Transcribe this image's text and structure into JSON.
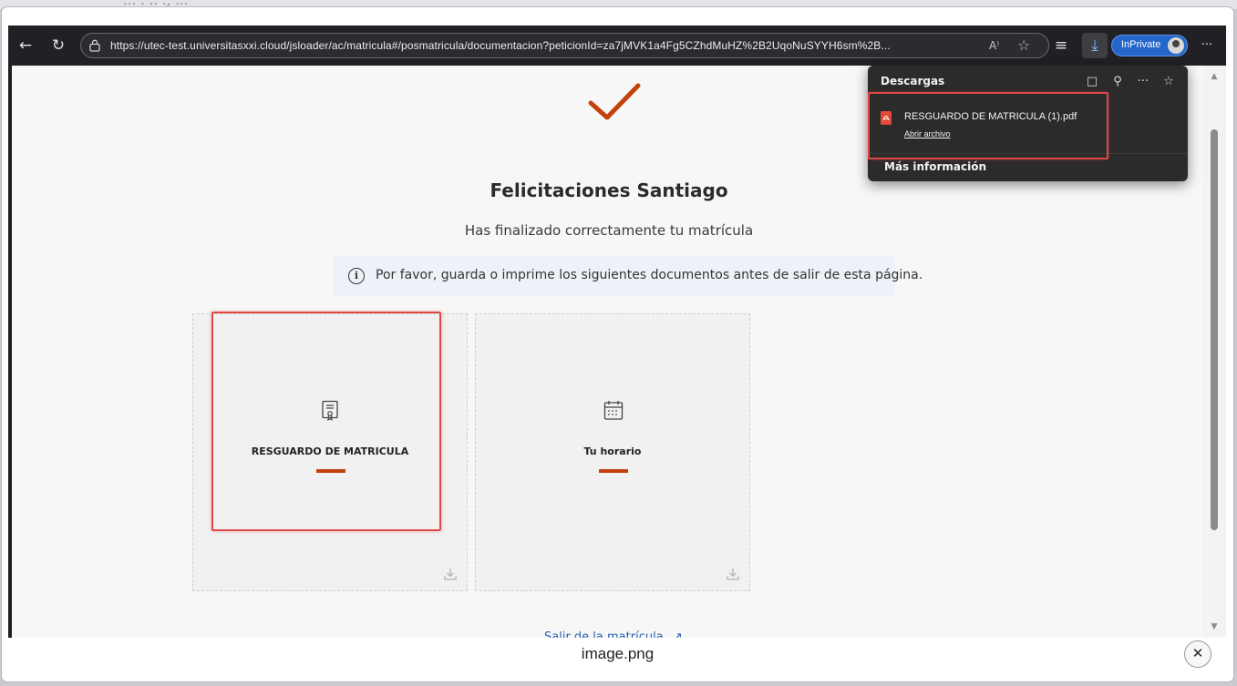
{
  "background": {
    "top_text": "... . .. ., ..."
  },
  "browser": {
    "url": "https://utec-test.universitasxxi.cloud/jsloader/ac/matricula#/posmatricula/documentacion?peticionId=za7jMVK1a4Fg5CZhdMuHZ%2B2UqoNuSYYH6sm%2B...",
    "inprivate_label": "InPrivate",
    "icons": {
      "back": "back-arrow-icon",
      "refresh": "refresh-icon",
      "read_aloud": "read-aloud-icon",
      "favorite": "star-icon",
      "favorites_list": "favorites-icon",
      "download": "download-icon",
      "more": "more-icon"
    },
    "read_aloud_glyph": "A⁾",
    "favorites_glyph": "☆",
    "favorites_list_glyph": "≡",
    "more_glyph": "···",
    "back_glyph": "←",
    "refresh_glyph": "↻",
    "download_glyph": "⤓"
  },
  "page": {
    "title": "Felicitaciones Santiago",
    "subtitle": "Has finalizado correctamente tu matrícula",
    "notice": "Por favor, guarda o imprime los siguientes documentos antes de salir de esta página.",
    "notice_glyph": "i",
    "cards": [
      {
        "label": "RESGUARDO DE MATRICULA",
        "icon": "certificate-icon"
      },
      {
        "label": "Tu horario",
        "icon": "calendar-icon"
      }
    ],
    "exit_link": "Salir de la matrícula",
    "exit_glyph": "↗",
    "accent_color": "#c2410c"
  },
  "downloads": {
    "title": "Descargas",
    "tool_glyphs": [
      "□",
      "⚲",
      "···",
      "☆"
    ],
    "tools": [
      "folder-icon",
      "search-icon",
      "more-icon",
      "pin-icon"
    ],
    "file_name": "RESGUARDO DE MATRICULA (1).pdf",
    "open_label": "Abrir archivo",
    "more_info": "Más información"
  },
  "lightbox": {
    "caption": "image.png",
    "close_glyph": "✕"
  }
}
